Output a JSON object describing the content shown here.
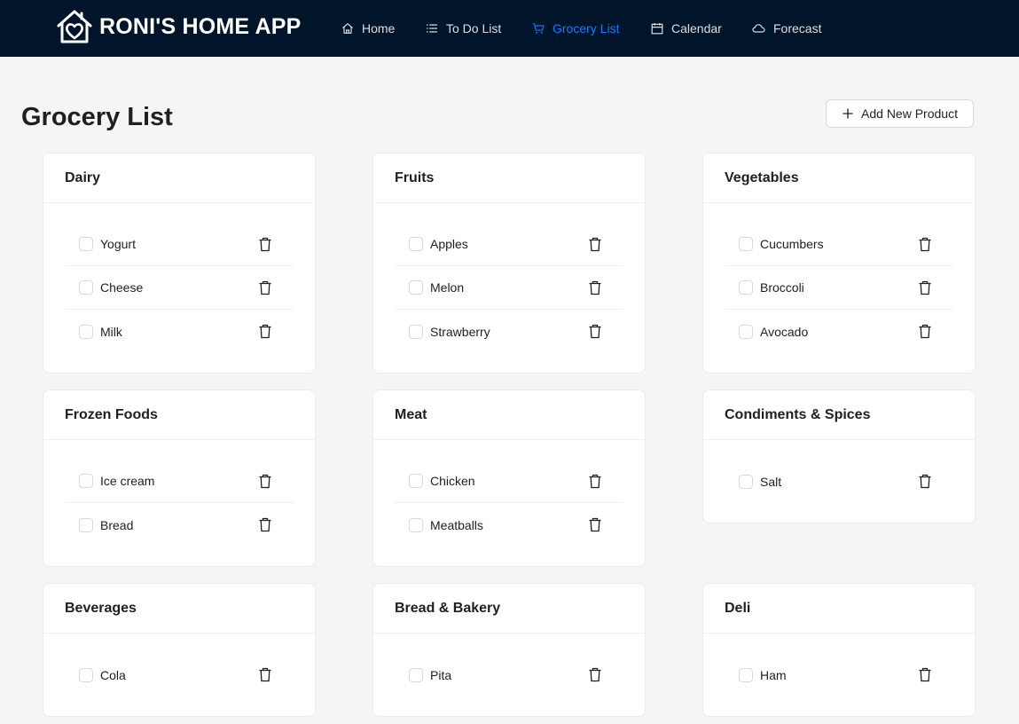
{
  "brand": {
    "name": "RONI'S HOME APP",
    "logo_icon": "house-heart-icon"
  },
  "nav": [
    {
      "label": "Home",
      "icon": "home-icon",
      "active": false
    },
    {
      "label": "To Do List",
      "icon": "list-icon",
      "active": false
    },
    {
      "label": "Grocery List",
      "icon": "cart-icon",
      "active": true
    },
    {
      "label": "Calendar",
      "icon": "calendar-icon",
      "active": false
    },
    {
      "label": "Forecast",
      "icon": "cloud-icon",
      "active": false
    }
  ],
  "page": {
    "title": "Grocery List",
    "add_button": "Add New Product"
  },
  "colors": {
    "navbar_bg": "#001529",
    "accent": "#1677ff",
    "page_bg": "#f5f5f5"
  },
  "categories": [
    {
      "name": "Dairy",
      "items": [
        "Yogurt",
        "Cheese",
        "Milk"
      ]
    },
    {
      "name": "Fruits",
      "items": [
        "Apples",
        "Melon",
        "Strawberry"
      ]
    },
    {
      "name": "Vegetables",
      "items": [
        "Cucumbers",
        "Broccoli",
        "Avocado"
      ]
    },
    {
      "name": "Frozen Foods",
      "items": [
        "Ice cream",
        "Bread"
      ]
    },
    {
      "name": "Meat",
      "items": [
        "Chicken",
        "Meatballs"
      ]
    },
    {
      "name": "Condiments & Spices",
      "items": [
        "Salt"
      ]
    },
    {
      "name": "Beverages",
      "items": [
        "Cola"
      ]
    },
    {
      "name": "Bread & Bakery",
      "items": [
        "Pita"
      ]
    },
    {
      "name": "Deli",
      "items": [
        "Ham"
      ]
    }
  ]
}
